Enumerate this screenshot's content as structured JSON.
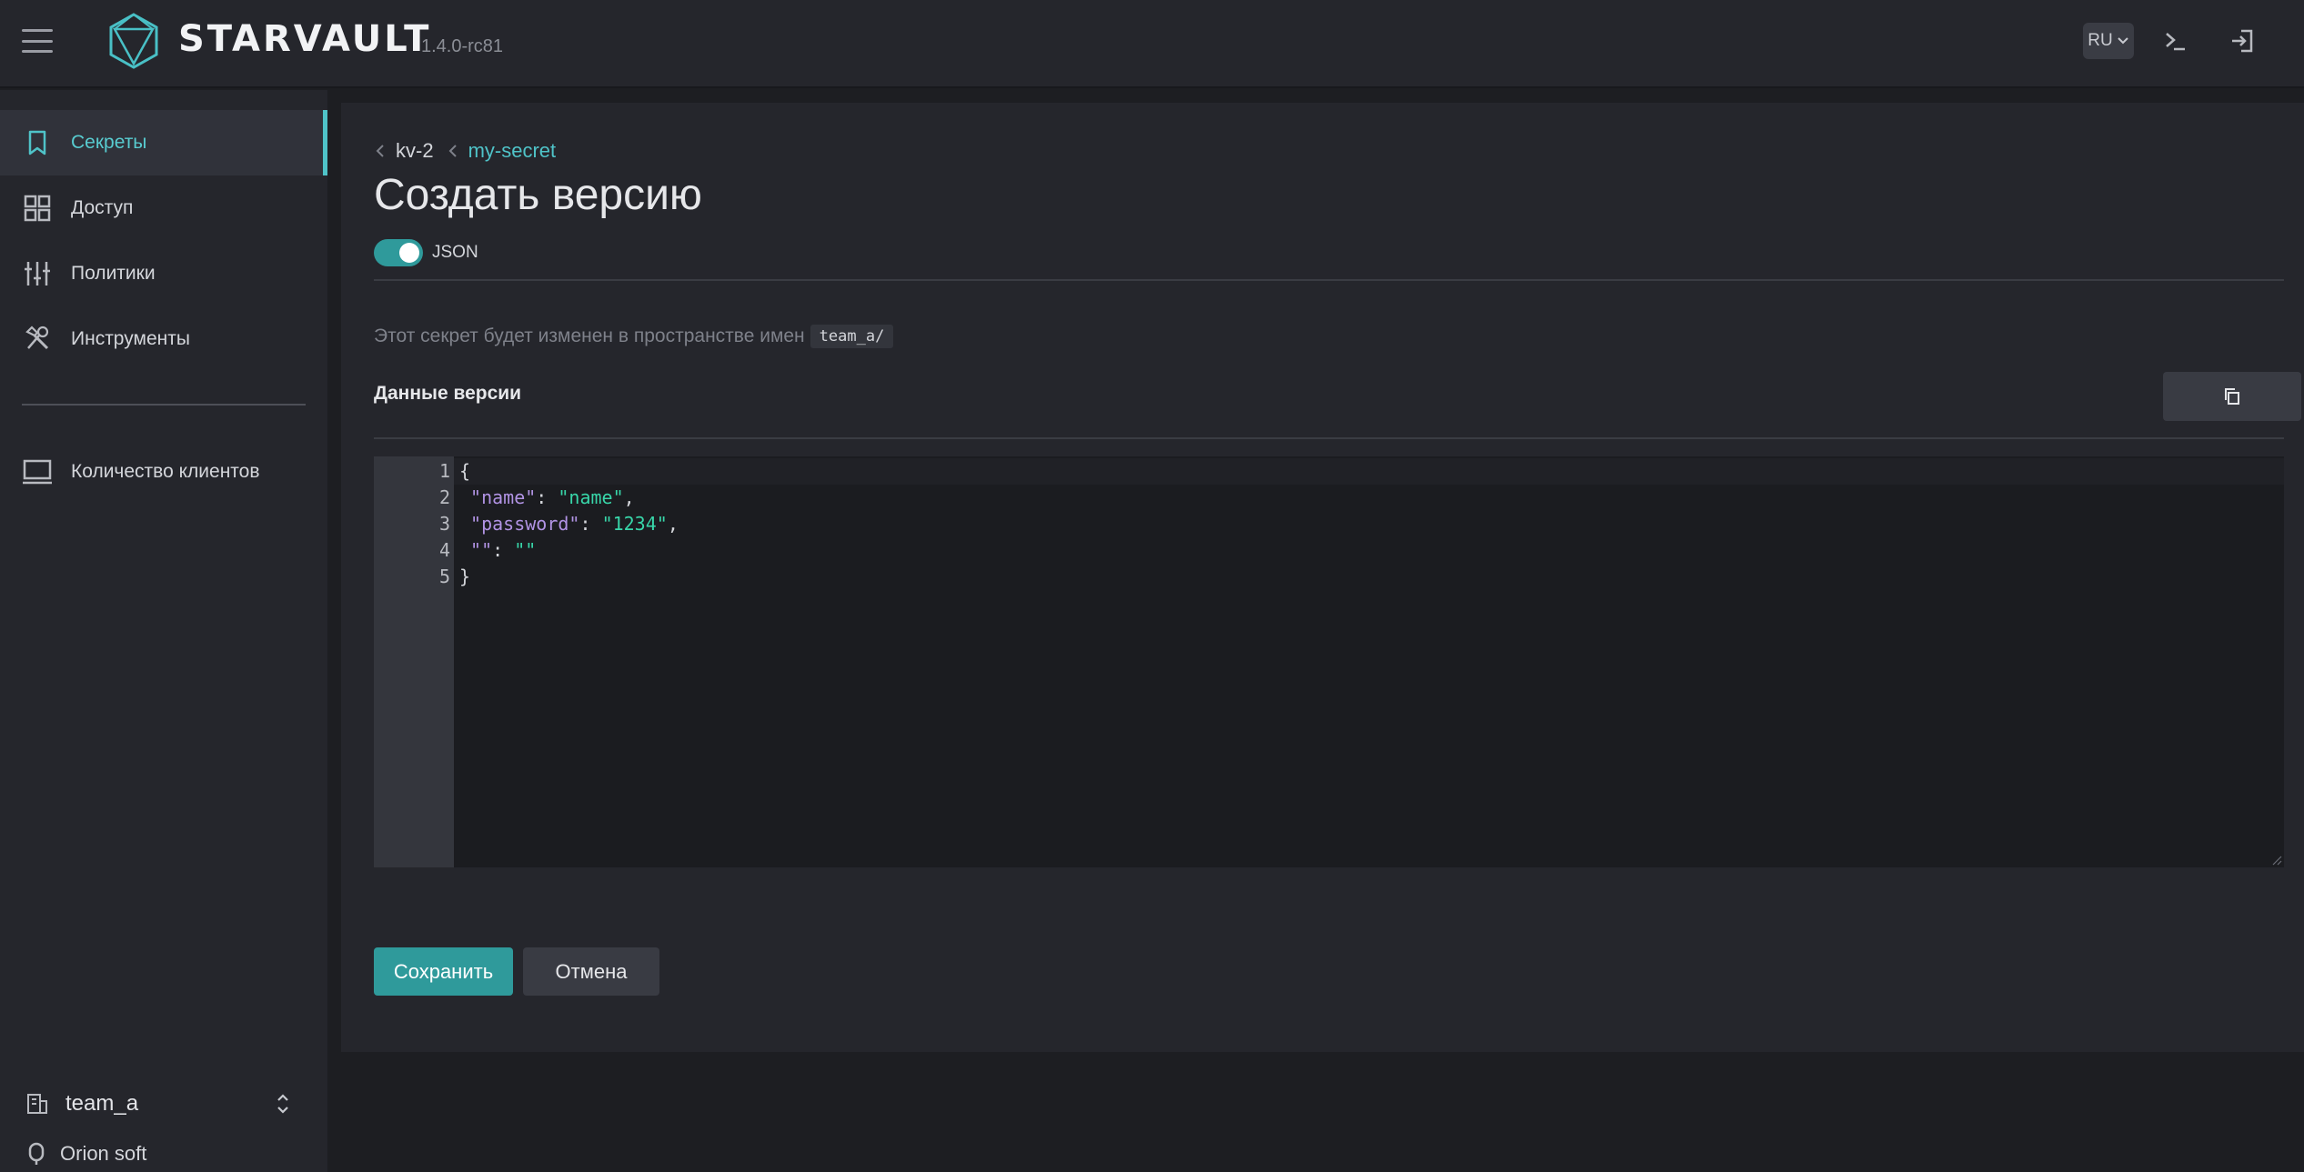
{
  "app": {
    "brand": "STARVAULT",
    "version": "1.4.0-rc81"
  },
  "header": {
    "lang": "RU",
    "icons": [
      "menu-icon",
      "terminal-icon",
      "logout-icon"
    ]
  },
  "sidebar": {
    "items": [
      {
        "label": "Секреты",
        "icon": "bookmark-icon",
        "active": true
      },
      {
        "label": "Доступ",
        "icon": "grid-icon",
        "active": false
      },
      {
        "label": "Политики",
        "icon": "sliders-icon",
        "active": false
      },
      {
        "label": "Инструменты",
        "icon": "tools-icon",
        "active": false
      },
      {
        "label": "Количество клиентов",
        "icon": "monitor-icon",
        "active": false
      }
    ],
    "namespace": "team_a",
    "org": "Orion soft"
  },
  "main": {
    "breadcrumbs": [
      "kv-2",
      "my-secret"
    ],
    "title": "Создать версию",
    "json_toggle_label": "JSON",
    "json_toggle_on": true,
    "namespace_note": "Этот секрет будет изменен в пространстве имен",
    "namespace_code": "team_a/",
    "section_title": "Данные версии",
    "editor_lines": [
      {
        "n": "1",
        "key": "",
        "val": "",
        "text": "{"
      },
      {
        "n": "2",
        "key": "\"name\"",
        "val": "\"name\"",
        "text": ","
      },
      {
        "n": "3",
        "key": "\"password\"",
        "val": "\"1234\"",
        "text": ","
      },
      {
        "n": "4",
        "key": "\"\"",
        "val": "\"\"",
        "text": ""
      },
      {
        "n": "5",
        "key": "",
        "val": "",
        "text": "}"
      }
    ],
    "save_label": "Сохранить",
    "cancel_label": "Отмена"
  },
  "colors": {
    "accent": "#4fc3c8",
    "primary_button": "#2f9a9b",
    "json_key": "#b193e4",
    "json_string": "#38d6a9"
  }
}
